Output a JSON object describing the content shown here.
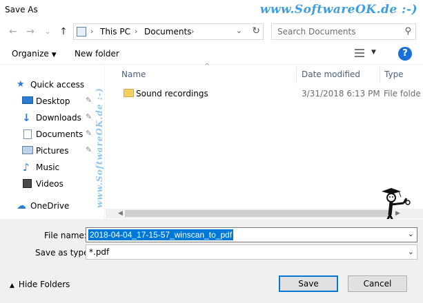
{
  "window": {
    "title": "Save As",
    "watermark": "www.SoftwareOK.de :-)",
    "close_glyph": "×"
  },
  "nav": {
    "back_glyph": "←",
    "forward_glyph": "→",
    "recent_glyph": "⌄",
    "up_glyph": "↑"
  },
  "address": {
    "crumbs": [
      "This PC",
      "Documents"
    ],
    "separator": "›",
    "refresh_glyph": "↻"
  },
  "search": {
    "placeholder": "Search Documents",
    "icon_glyph": "⚲"
  },
  "toolbar": {
    "organize_label": "Organize",
    "new_folder_label": "New folder",
    "help_label": "?"
  },
  "sidebar": {
    "items": [
      {
        "label": "Quick access",
        "icon": "star-icon",
        "pinned": false
      },
      {
        "label": "Desktop",
        "icon": "desktop-icon",
        "pinned": true
      },
      {
        "label": "Downloads",
        "icon": "download-icon",
        "pinned": true
      },
      {
        "label": "Documents",
        "icon": "document-icon",
        "pinned": true
      },
      {
        "label": "Pictures",
        "icon": "picture-icon",
        "pinned": true
      },
      {
        "label": "Music",
        "icon": "music-icon",
        "pinned": false
      },
      {
        "label": "Videos",
        "icon": "video-icon",
        "pinned": false
      },
      {
        "label": "OneDrive",
        "icon": "cloud-icon",
        "pinned": false
      }
    ],
    "side_watermark": "www.SoftwareOK.de :-)",
    "pin_glyph": "📌"
  },
  "file_list": {
    "columns": [
      "Name",
      "Date modified",
      "Type"
    ],
    "rows": [
      {
        "name": "Sound recordings",
        "date": "3/31/2018 6:13 PM",
        "type": "File folde"
      }
    ]
  },
  "form": {
    "file_name_label": "File name:",
    "file_name_value": "2018-04-04_17-15-57_winscan_to_pdf",
    "save_as_type_label": "Save as type:",
    "save_as_type_value": "*.pdf"
  },
  "footer": {
    "hide_folders_label": "Hide Folders",
    "save_label": "Save",
    "cancel_label": "Cancel"
  },
  "colors": {
    "accent": "#0078d7",
    "watermark": "#3b9fe0"
  }
}
